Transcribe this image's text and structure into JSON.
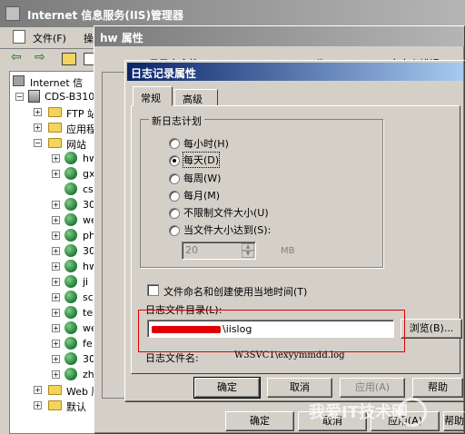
{
  "main_window": {
    "title": "Internet 信息服务(IIS)管理器",
    "menu": [
      "文件(F)",
      "操"
    ]
  },
  "tree": {
    "root": "Internet 信",
    "server": "CDS-B310",
    "nodes": [
      "FTP 站",
      "应用程",
      "网站"
    ],
    "sites": [
      "hw",
      "gx",
      "cs",
      "30",
      "we",
      "ph",
      "30",
      "hw",
      "ji",
      "sc",
      "te",
      "we",
      "fe",
      "30",
      "zh"
    ],
    "web_node": "Web 服",
    "default_node": "默认"
  },
  "props_window": {
    "title": "hw 属性",
    "tab_hints": [
      "日录安全性",
      "HTTP 头",
      "自定义错误"
    ],
    "buttons": {
      "ok": "确定",
      "cancel": "取消",
      "apply": "应用(A)",
      "help": "帮助"
    }
  },
  "dialog": {
    "title": "日志记录属性",
    "tabs": [
      "常规",
      "高级"
    ],
    "group_title": "新日志计划",
    "options": [
      "每小时(H)",
      "每天(D)",
      "每周(W)",
      "每月(M)",
      "不限制文件大小(U)",
      "当文件大小达到(S):"
    ],
    "selected_option": 1,
    "size_value": "20",
    "size_unit": "MB",
    "checkbox_label": "文件命名和创建使用当地时间(T)",
    "dir_label": "日志文件目录(L):",
    "dir_value": "\\iislog",
    "browse": "浏览(B)...",
    "filename_label": "日志文件名:",
    "filename_value": "W3SVC1\\exyymmdd.log",
    "buttons": {
      "ok": "确定",
      "cancel": "取消",
      "apply": "应用(A)",
      "help": "帮助"
    }
  },
  "watermark": "我爱IT技术网",
  "colors": {
    "title_active": "#0a246a",
    "highlight": "#e00000"
  }
}
